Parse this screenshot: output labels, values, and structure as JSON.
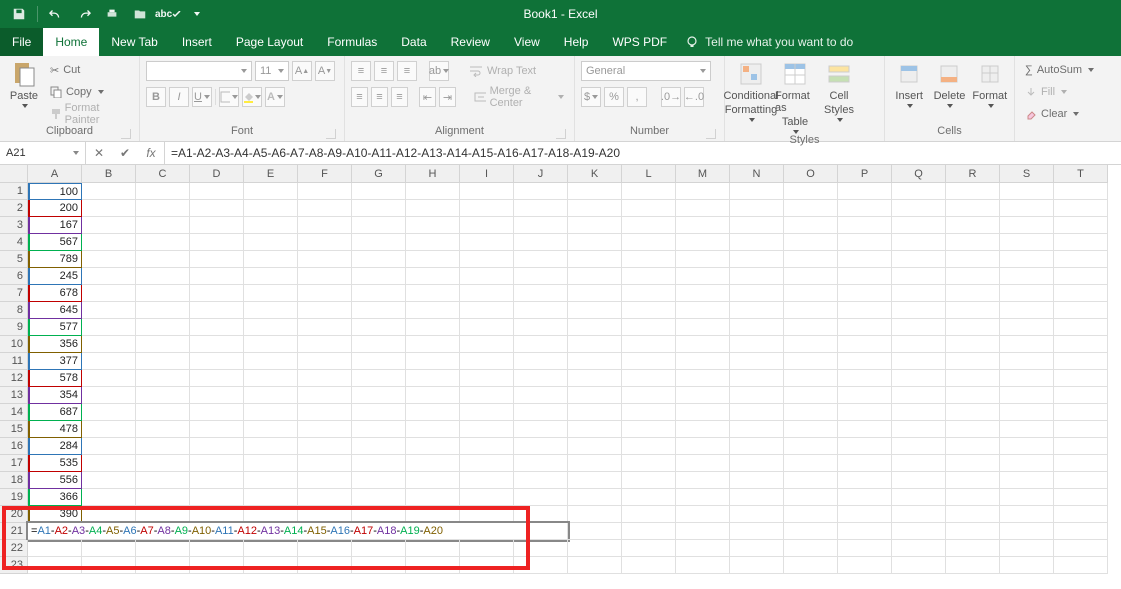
{
  "app": {
    "title": "Book1 - Excel"
  },
  "qat": {
    "save": "save-icon",
    "undo": "undo-icon",
    "redo": "redo-icon",
    "quickprint": "quickprint-icon",
    "open": "open-icon",
    "spell": "spell-icon"
  },
  "menu": {
    "file": "File",
    "home": "Home",
    "newtab": "New Tab",
    "insert": "Insert",
    "pagelayout": "Page Layout",
    "formulas": "Formulas",
    "data": "Data",
    "review": "Review",
    "view": "View",
    "help": "Help",
    "wpspdf": "WPS PDF",
    "tell": "Tell me what you want to do"
  },
  "ribbon": {
    "clipboard": {
      "label": "Clipboard",
      "paste": "Paste",
      "cut": "Cut",
      "copy": "Copy",
      "painter": "Format Painter"
    },
    "font": {
      "label": "Font",
      "family": "",
      "size": "11",
      "bold": "B",
      "italic": "I",
      "underline": "U"
    },
    "alignment": {
      "label": "Alignment",
      "wrap": "Wrap Text",
      "merge": "Merge & Center"
    },
    "number": {
      "label": "Number",
      "format": "General"
    },
    "styles": {
      "label": "Styles",
      "cond": "Conditional",
      "cond2": "Formatting",
      "table": "Format as",
      "table2": "Table",
      "cell": "Cell",
      "cell2": "Styles"
    },
    "cells": {
      "label": "Cells",
      "insert": "Insert",
      "delete": "Delete",
      "format": "Format"
    },
    "editing": {
      "autosum": "AutoSum",
      "fill": "Fill",
      "clear": "Clear"
    }
  },
  "fx": {
    "name": "A21",
    "formula": "=A1-A2-A3-A4-A5-A6-A7-A8-A9-A10-A11-A12-A13-A14-A15-A16-A17-A18-A19-A20"
  },
  "columns": [
    "A",
    "B",
    "C",
    "D",
    "E",
    "F",
    "G",
    "H",
    "I",
    "J",
    "K",
    "L",
    "M",
    "N",
    "O",
    "P",
    "Q",
    "R",
    "S",
    "T"
  ],
  "rows": [
    1,
    2,
    3,
    4,
    5,
    6,
    7,
    8,
    9,
    10,
    11,
    12,
    13,
    14,
    15,
    16,
    17,
    18,
    19,
    20,
    21,
    22,
    23
  ],
  "colA": [
    "100",
    "200",
    "167",
    "567",
    "789",
    "245",
    "678",
    "645",
    "577",
    "356",
    "377",
    "578",
    "354",
    "687",
    "478",
    "284",
    "535",
    "556",
    "366",
    "390"
  ],
  "refColors": [
    "#2e75b6",
    "#c00000",
    "#7030a0",
    "#00b050",
    "#806000",
    "#2e75b6",
    "#c00000",
    "#7030a0",
    "#00b050",
    "#806000",
    "#2e75b6",
    "#c00000",
    "#7030a0",
    "#00b050",
    "#806000",
    "#2e75b6",
    "#c00000",
    "#7030a0",
    "#00b050",
    "#806000"
  ],
  "editTokens": [
    {
      "t": "=",
      "c": "#000"
    },
    {
      "t": "A1",
      "c": "#2e75b6"
    },
    {
      "t": "-",
      "c": "#000"
    },
    {
      "t": "A2",
      "c": "#c00000"
    },
    {
      "t": "-",
      "c": "#000"
    },
    {
      "t": "A3",
      "c": "#7030a0"
    },
    {
      "t": "-",
      "c": "#000"
    },
    {
      "t": "A4",
      "c": "#00b050"
    },
    {
      "t": "-",
      "c": "#000"
    },
    {
      "t": "A5",
      "c": "#806000"
    },
    {
      "t": "-",
      "c": "#000"
    },
    {
      "t": "A6",
      "c": "#2e75b6"
    },
    {
      "t": "-",
      "c": "#000"
    },
    {
      "t": "A7",
      "c": "#c00000"
    },
    {
      "t": "-",
      "c": "#000"
    },
    {
      "t": "A8",
      "c": "#7030a0"
    },
    {
      "t": "-",
      "c": "#000"
    },
    {
      "t": "A9",
      "c": "#00b050"
    },
    {
      "t": "-",
      "c": "#000"
    },
    {
      "t": "A10",
      "c": "#806000"
    },
    {
      "t": "-",
      "c": "#000"
    },
    {
      "t": "A11",
      "c": "#2e75b6"
    },
    {
      "t": "-",
      "c": "#000"
    },
    {
      "t": "A12",
      "c": "#c00000"
    },
    {
      "t": "-",
      "c": "#000"
    },
    {
      "t": "A13",
      "c": "#7030a0"
    },
    {
      "t": "-",
      "c": "#000"
    },
    {
      "t": "A14",
      "c": "#00b050"
    },
    {
      "t": "-",
      "c": "#000"
    },
    {
      "t": "A15",
      "c": "#806000"
    },
    {
      "t": "-",
      "c": "#000"
    },
    {
      "t": "A16",
      "c": "#2e75b6"
    },
    {
      "t": "-",
      "c": "#000"
    },
    {
      "t": "A17",
      "c": "#c00000"
    },
    {
      "t": "-",
      "c": "#000"
    },
    {
      "t": "A18",
      "c": "#7030a0"
    },
    {
      "t": "-",
      "c": "#000"
    },
    {
      "t": "A19",
      "c": "#00b050"
    },
    {
      "t": "-",
      "c": "#000"
    },
    {
      "t": "A20",
      "c": "#806000"
    }
  ],
  "sigma": "∑"
}
